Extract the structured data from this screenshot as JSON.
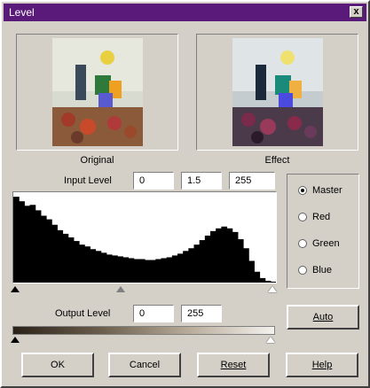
{
  "window": {
    "title": "Level",
    "close_label": "x"
  },
  "previews": {
    "original_caption": "Original",
    "effect_caption": "Effect"
  },
  "input_level": {
    "label": "Input Level",
    "values": [
      "0",
      "1.5",
      "255"
    ]
  },
  "channels": {
    "options": [
      "Master",
      "Red",
      "Green",
      "Blue"
    ],
    "selected": "Master"
  },
  "output_level": {
    "label": "Output Level",
    "values": [
      "0",
      "255"
    ]
  },
  "buttons": {
    "auto": "Auto",
    "ok": "OK",
    "cancel": "Cancel",
    "reset": "Reset",
    "help": "Help"
  },
  "histogram": {
    "values": [
      0.95,
      0.9,
      0.85,
      0.86,
      0.8,
      0.74,
      0.7,
      0.64,
      0.58,
      0.54,
      0.5,
      0.46,
      0.42,
      0.4,
      0.37,
      0.35,
      0.33,
      0.31,
      0.3,
      0.29,
      0.28,
      0.27,
      0.26,
      0.26,
      0.25,
      0.25,
      0.26,
      0.27,
      0.28,
      0.3,
      0.32,
      0.35,
      0.38,
      0.42,
      0.47,
      0.52,
      0.57,
      0.6,
      0.62,
      0.6,
      0.56,
      0.48,
      0.38,
      0.24,
      0.12,
      0.05,
      0.02,
      0.01
    ]
  },
  "colors": {
    "titlebar": "#5a1a7a",
    "face": "#d4d0c8"
  }
}
